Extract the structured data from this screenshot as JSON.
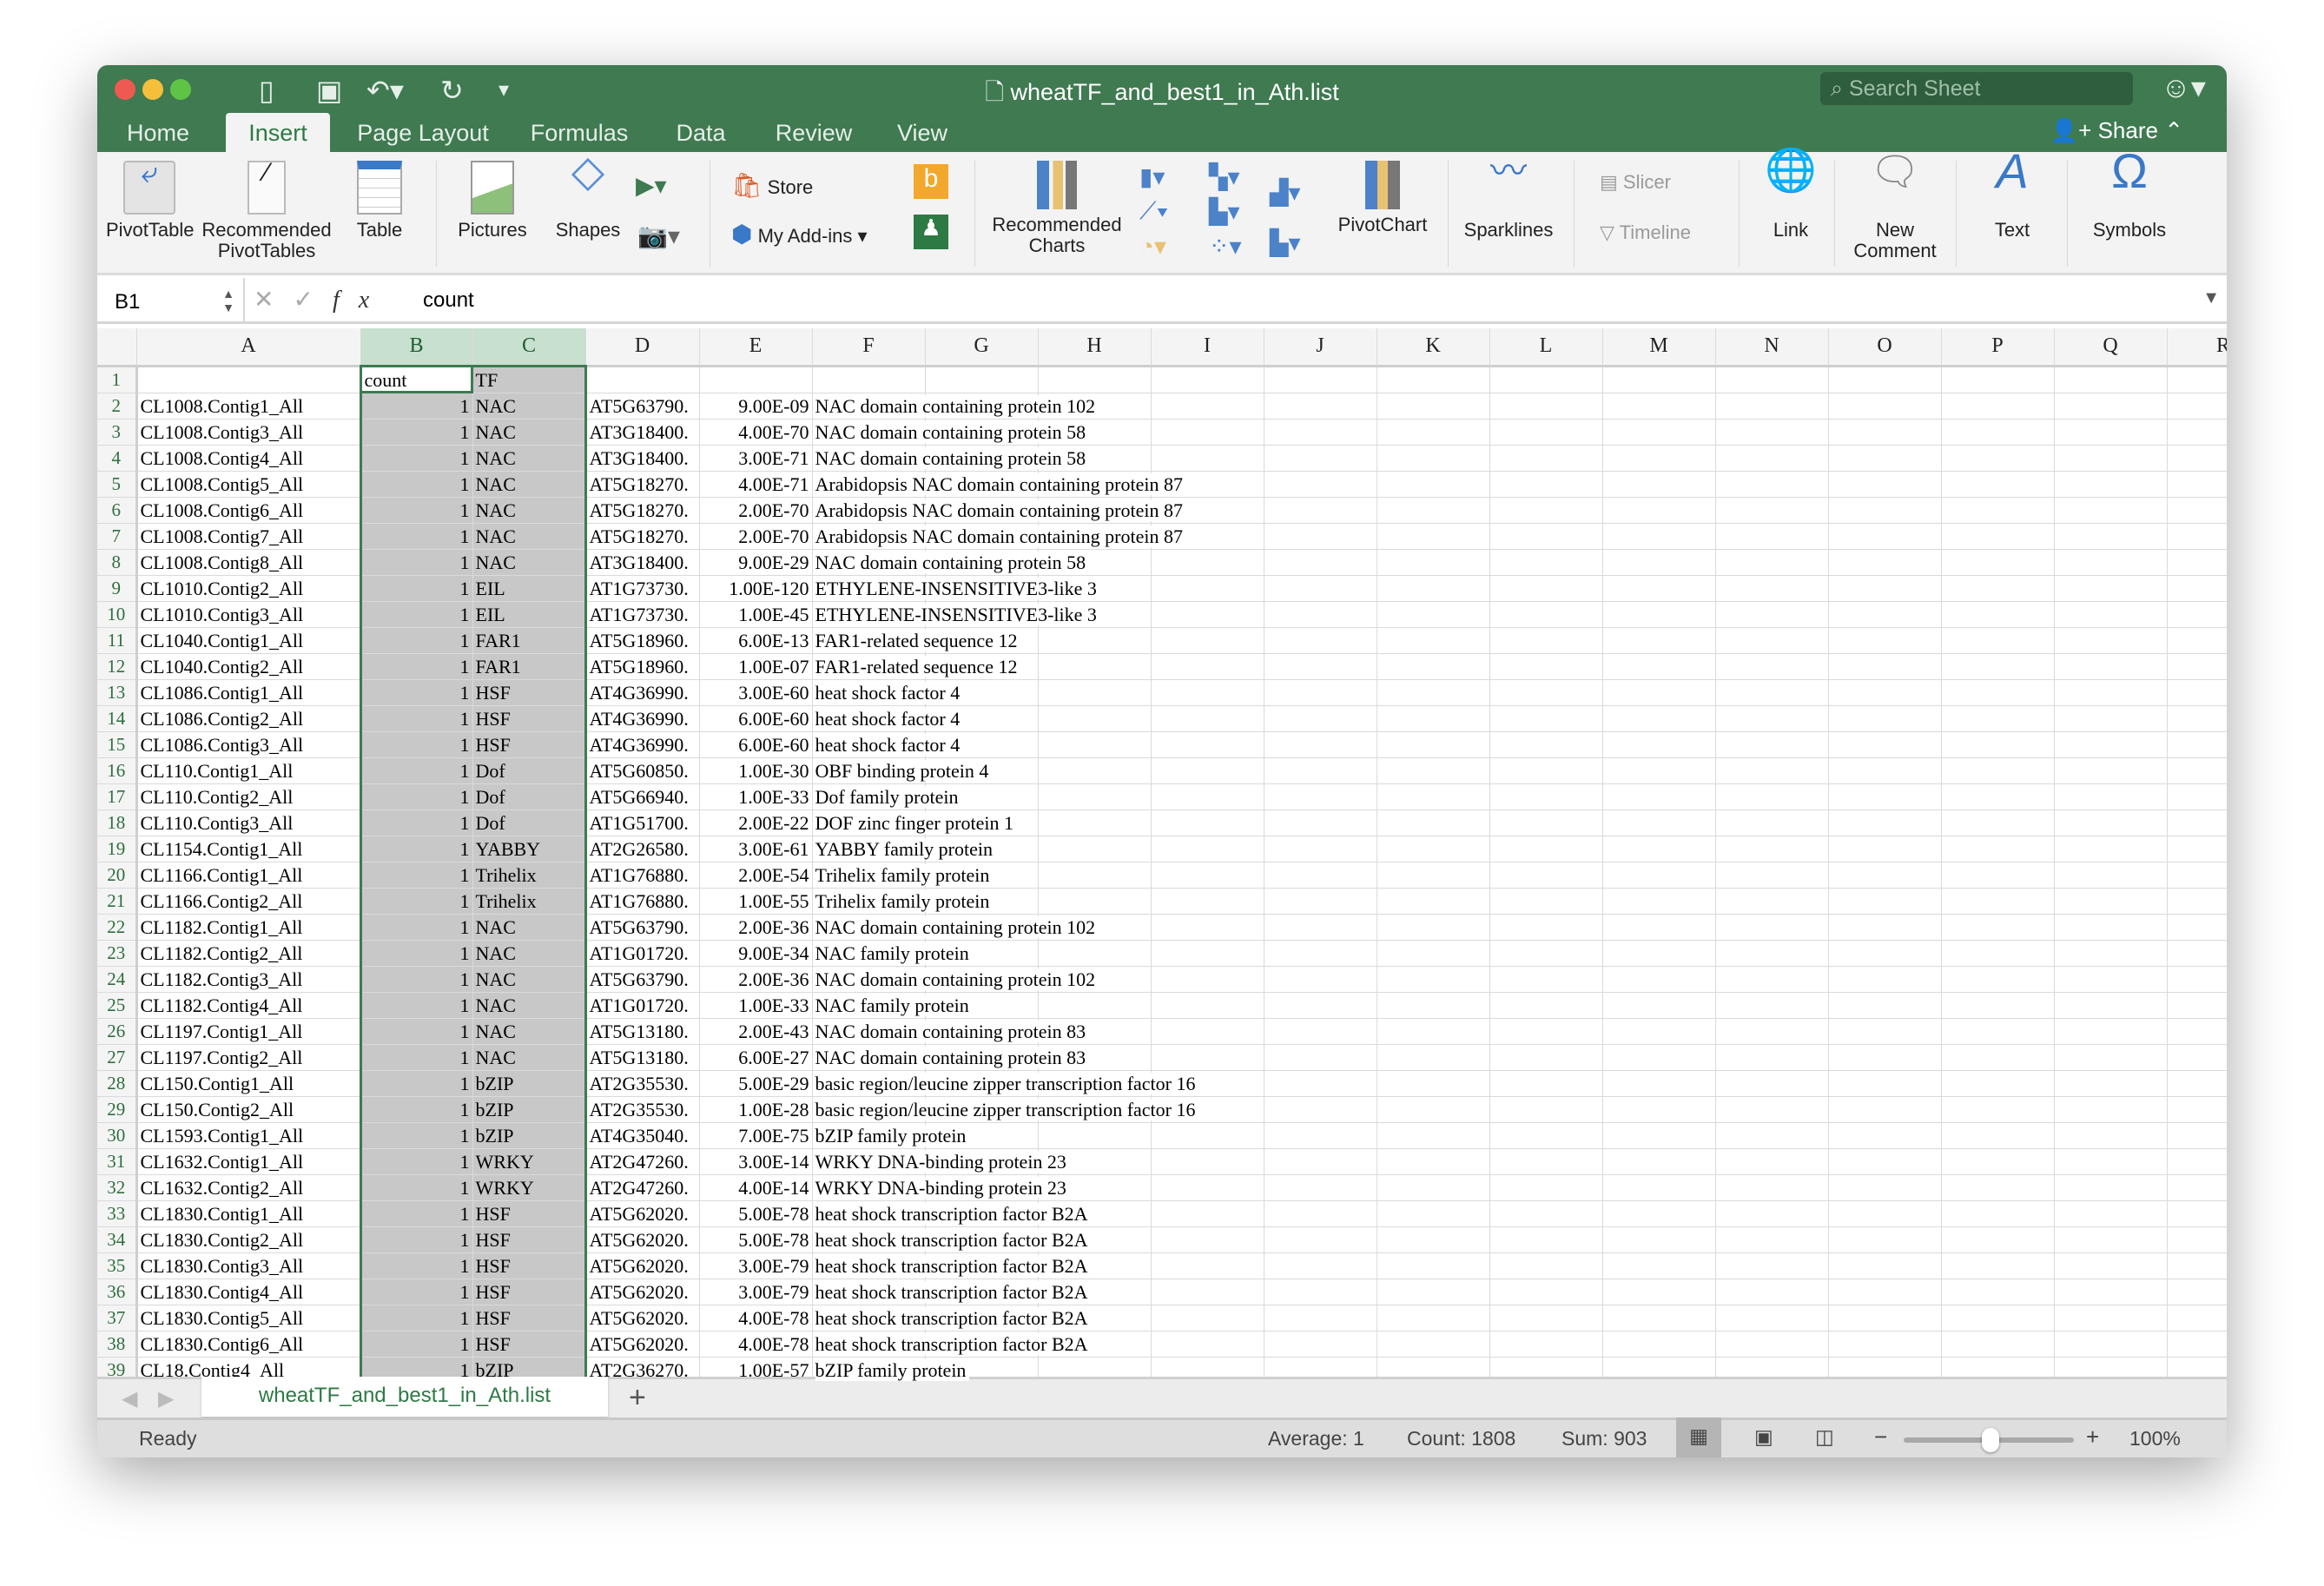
{
  "window": {
    "title": "wheatTF_and_best1_in_Ath.list",
    "search_placeholder": "Search Sheet",
    "share_label": "Share"
  },
  "tabs": [
    "Home",
    "Insert",
    "Page Layout",
    "Formulas",
    "Data",
    "Review",
    "View"
  ],
  "active_tab": "Insert",
  "ribbon": {
    "pivottable": "PivotTable",
    "recommended_pivottables": "Recommended PivotTables",
    "table": "Table",
    "pictures": "Pictures",
    "shapes": "Shapes",
    "store": "Store",
    "my_addins": "My Add-ins",
    "recommended_charts": "Recommended Charts",
    "pivotchart": "PivotChart",
    "sparklines": "Sparklines",
    "slicer": "Slicer",
    "timeline": "Timeline",
    "link": "Link",
    "new_comment": "New Comment",
    "text": "Text",
    "symbols": "Symbols"
  },
  "formula_bar": {
    "name_box": "B1",
    "fx": "fx",
    "value": "count"
  },
  "columns": [
    "A",
    "B",
    "C",
    "D",
    "E",
    "F",
    "G",
    "H",
    "I",
    "J",
    "K",
    "L",
    "M",
    "N",
    "O",
    "P",
    "Q",
    "R"
  ],
  "header_row": {
    "B": "count",
    "C": "TF"
  },
  "rows": [
    [
      "CL1008.Contig1_All",
      "1",
      "NAC",
      "AT5G63790.",
      "9.00E-09",
      "NAC domain containing protein 102"
    ],
    [
      "CL1008.Contig3_All",
      "1",
      "NAC",
      "AT3G18400.",
      "4.00E-70",
      "NAC domain containing protein 58"
    ],
    [
      "CL1008.Contig4_All",
      "1",
      "NAC",
      "AT3G18400.",
      "3.00E-71",
      "NAC domain containing protein 58"
    ],
    [
      "CL1008.Contig5_All",
      "1",
      "NAC",
      "AT5G18270.",
      "4.00E-71",
      "Arabidopsis NAC domain containing protein 87"
    ],
    [
      "CL1008.Contig6_All",
      "1",
      "NAC",
      "AT5G18270.",
      "2.00E-70",
      "Arabidopsis NAC domain containing protein 87"
    ],
    [
      "CL1008.Contig7_All",
      "1",
      "NAC",
      "AT5G18270.",
      "2.00E-70",
      "Arabidopsis NAC domain containing protein 87"
    ],
    [
      "CL1008.Contig8_All",
      "1",
      "NAC",
      "AT3G18400.",
      "9.00E-29",
      "NAC domain containing protein 58"
    ],
    [
      "CL1010.Contig2_All",
      "1",
      "EIL",
      "AT1G73730.",
      "1.00E-120",
      "ETHYLENE-INSENSITIVE3-like 3"
    ],
    [
      "CL1010.Contig3_All",
      "1",
      "EIL",
      "AT1G73730.",
      "1.00E-45",
      "ETHYLENE-INSENSITIVE3-like 3"
    ],
    [
      "CL1040.Contig1_All",
      "1",
      "FAR1",
      "AT5G18960.",
      "6.00E-13",
      "FAR1-related sequence 12"
    ],
    [
      "CL1040.Contig2_All",
      "1",
      "FAR1",
      "AT5G18960.",
      "1.00E-07",
      "FAR1-related sequence 12"
    ],
    [
      "CL1086.Contig1_All",
      "1",
      "HSF",
      "AT4G36990.",
      "3.00E-60",
      "heat shock factor 4"
    ],
    [
      "CL1086.Contig2_All",
      "1",
      "HSF",
      "AT4G36990.",
      "6.00E-60",
      "heat shock factor 4"
    ],
    [
      "CL1086.Contig3_All",
      "1",
      "HSF",
      "AT4G36990.",
      "6.00E-60",
      "heat shock factor 4"
    ],
    [
      "CL110.Contig1_All",
      "1",
      "Dof",
      "AT5G60850.",
      "1.00E-30",
      "OBF binding protein 4"
    ],
    [
      "CL110.Contig2_All",
      "1",
      "Dof",
      "AT5G66940.",
      "1.00E-33",
      "Dof family protein"
    ],
    [
      "CL110.Contig3_All",
      "1",
      "Dof",
      "AT1G51700.",
      "2.00E-22",
      "DOF zinc finger protein 1"
    ],
    [
      "CL1154.Contig1_All",
      "1",
      "YABBY",
      "AT2G26580.",
      "3.00E-61",
      "YABBY family protein"
    ],
    [
      "CL1166.Contig1_All",
      "1",
      "Trihelix",
      "AT1G76880.",
      "2.00E-54",
      "Trihelix family protein"
    ],
    [
      "CL1166.Contig2_All",
      "1",
      "Trihelix",
      "AT1G76880.",
      "1.00E-55",
      "Trihelix family protein"
    ],
    [
      "CL1182.Contig1_All",
      "1",
      "NAC",
      "AT5G63790.",
      "2.00E-36",
      "NAC domain containing protein 102"
    ],
    [
      "CL1182.Contig2_All",
      "1",
      "NAC",
      "AT1G01720.",
      "9.00E-34",
      "NAC family protein"
    ],
    [
      "CL1182.Contig3_All",
      "1",
      "NAC",
      "AT5G63790.",
      "2.00E-36",
      "NAC domain containing protein 102"
    ],
    [
      "CL1182.Contig4_All",
      "1",
      "NAC",
      "AT1G01720.",
      "1.00E-33",
      "NAC family protein"
    ],
    [
      "CL1197.Contig1_All",
      "1",
      "NAC",
      "AT5G13180.",
      "2.00E-43",
      "NAC domain containing protein 83"
    ],
    [
      "CL1197.Contig2_All",
      "1",
      "NAC",
      "AT5G13180.",
      "6.00E-27",
      "NAC domain containing protein 83"
    ],
    [
      "CL150.Contig1_All",
      "1",
      "bZIP",
      "AT2G35530.",
      "5.00E-29",
      "basic region/leucine zipper transcription factor 16"
    ],
    [
      "CL150.Contig2_All",
      "1",
      "bZIP",
      "AT2G35530.",
      "1.00E-28",
      "basic region/leucine zipper transcription factor 16"
    ],
    [
      "CL1593.Contig1_All",
      "1",
      "bZIP",
      "AT4G35040.",
      "7.00E-75",
      "bZIP family protein"
    ],
    [
      "CL1632.Contig1_All",
      "1",
      "WRKY",
      "AT2G47260.",
      "3.00E-14",
      "WRKY DNA-binding protein 23"
    ],
    [
      "CL1632.Contig2_All",
      "1",
      "WRKY",
      "AT2G47260.",
      "4.00E-14",
      "WRKY DNA-binding protein 23"
    ],
    [
      "CL1830.Contig1_All",
      "1",
      "HSF",
      "AT5G62020.",
      "5.00E-78",
      "heat shock transcription factor B2A"
    ],
    [
      "CL1830.Contig2_All",
      "1",
      "HSF",
      "AT5G62020.",
      "5.00E-78",
      "heat shock transcription factor B2A"
    ],
    [
      "CL1830.Contig3_All",
      "1",
      "HSF",
      "AT5G62020.",
      "3.00E-79",
      "heat shock transcription factor B2A"
    ],
    [
      "CL1830.Contig4_All",
      "1",
      "HSF",
      "AT5G62020.",
      "3.00E-79",
      "heat shock transcription factor B2A"
    ],
    [
      "CL1830.Contig5_All",
      "1",
      "HSF",
      "AT5G62020.",
      "4.00E-78",
      "heat shock transcription factor B2A"
    ],
    [
      "CL1830.Contig6_All",
      "1",
      "HSF",
      "AT5G62020.",
      "4.00E-78",
      "heat shock transcription factor B2A"
    ],
    [
      "CL18.Contig4_All",
      "1",
      "bZIP",
      "AT2G36270.",
      "1.00E-57",
      "bZIP family protein"
    ]
  ],
  "sheet_tab": "wheatTF_and_best1_in_Ath.list",
  "status": {
    "ready": "Ready",
    "average": "Average: 1",
    "count": "Count: 1808",
    "sum": "Sum: 903",
    "zoom": "100%",
    "zoom_level": 100
  },
  "colors": {
    "accent": "#3f7a51",
    "selection": "#c8c8c8"
  }
}
